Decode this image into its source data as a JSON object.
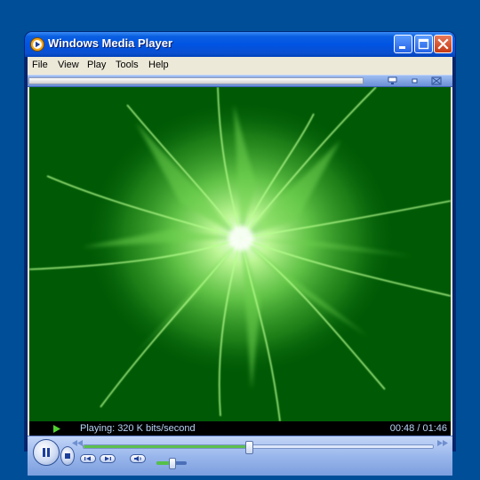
{
  "window": {
    "title": "Windows Media Player",
    "app_icon": "media-player-icon",
    "buttons": [
      "minimize-icon",
      "maximize-icon",
      "close-icon"
    ]
  },
  "menu": {
    "items": [
      {
        "label": "File"
      },
      {
        "label": "View"
      },
      {
        "label": "Play"
      },
      {
        "label": "Tools"
      },
      {
        "label": "Help"
      }
    ]
  },
  "taskbar": {
    "icons": [
      "now-playing-icon",
      "compact-icon",
      "fullscreen-icon"
    ]
  },
  "visualization": {
    "background_color": "#005a05",
    "glow_color": "#9eff7a"
  },
  "status": {
    "text": "Playing: 320 K bits/second",
    "time": "00:48 / 01:46",
    "indicator_icon": "play-indicator-icon",
    "indicator_color": "#4fd32e"
  },
  "controls": {
    "seek_progress": 0.47,
    "volume_level": 0.5,
    "buttons": [
      "pause-icon",
      "stop-icon",
      "previous-icon",
      "next-icon",
      "mute-icon"
    ],
    "seek_fill_color": "#5cc04d"
  }
}
